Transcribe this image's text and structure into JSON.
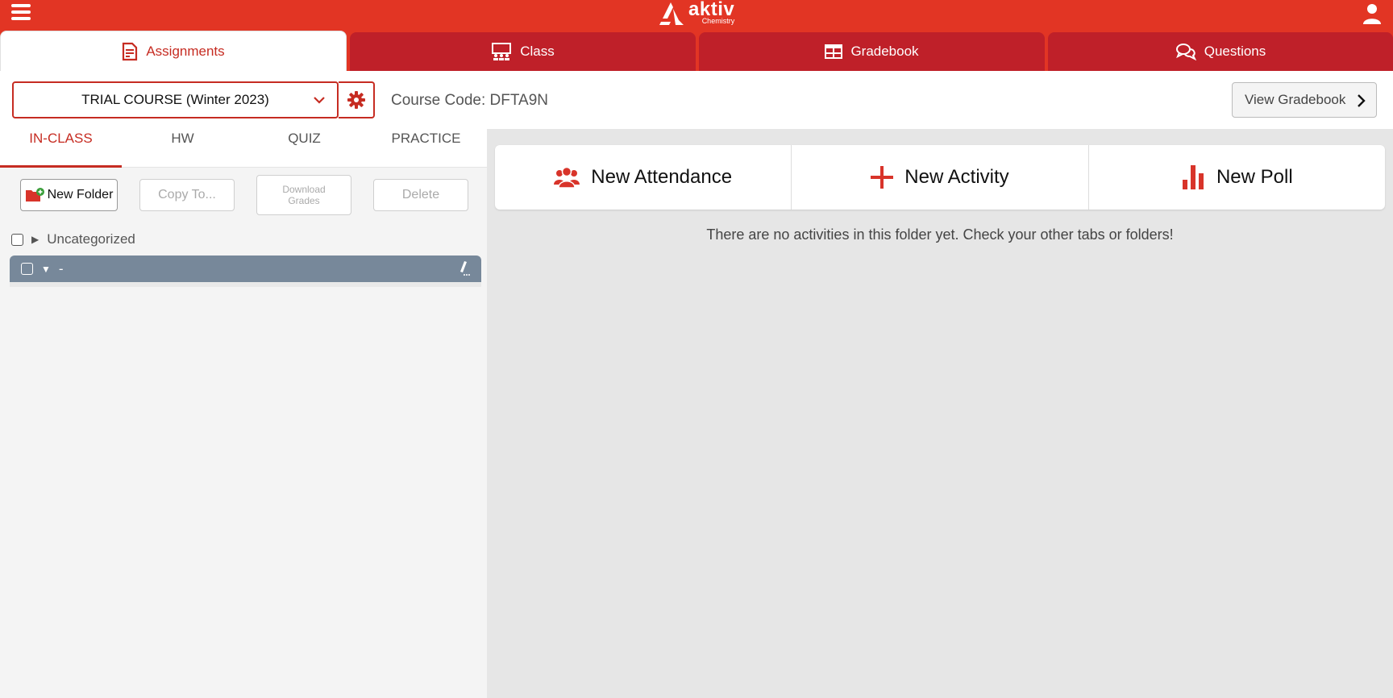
{
  "app": {
    "logo_name": "aktiv",
    "logo_sub": "Chemistry"
  },
  "main_tabs": [
    {
      "label": "Assignments",
      "icon": "document-icon"
    },
    {
      "label": "Class",
      "icon": "classroom-icon"
    },
    {
      "label": "Gradebook",
      "icon": "table-icon"
    },
    {
      "label": "Questions",
      "icon": "chat-bubbles-icon"
    }
  ],
  "course": {
    "selected": "TRIAL COURSE (Winter 2023)",
    "code_text": "Course Code: DFTA9N"
  },
  "header": {
    "view_gradebook_label": "View Gradebook"
  },
  "sub_tabs": [
    {
      "label": "IN-CLASS"
    },
    {
      "label": "HW"
    },
    {
      "label": "QUIZ"
    },
    {
      "label": "PRACTICE"
    }
  ],
  "toolbar": {
    "new_folder": "New Folder",
    "copy_to": "Copy To...",
    "download_grades_line1": "Download",
    "download_grades_line2": "Grades",
    "delete": "Delete"
  },
  "folders": [
    {
      "name": "Uncategorized"
    },
    {
      "name": "-"
    }
  ],
  "actions": {
    "new_attendance": "New Attendance",
    "new_activity": "New Activity",
    "new_poll": "New Poll"
  },
  "empty_message": "There are no activities in this folder yet. Check your other tabs or folders!",
  "colors": {
    "brand_red": "#e23524",
    "tab_dark_red": "#bf2029",
    "selected_folder": "#77889a"
  }
}
